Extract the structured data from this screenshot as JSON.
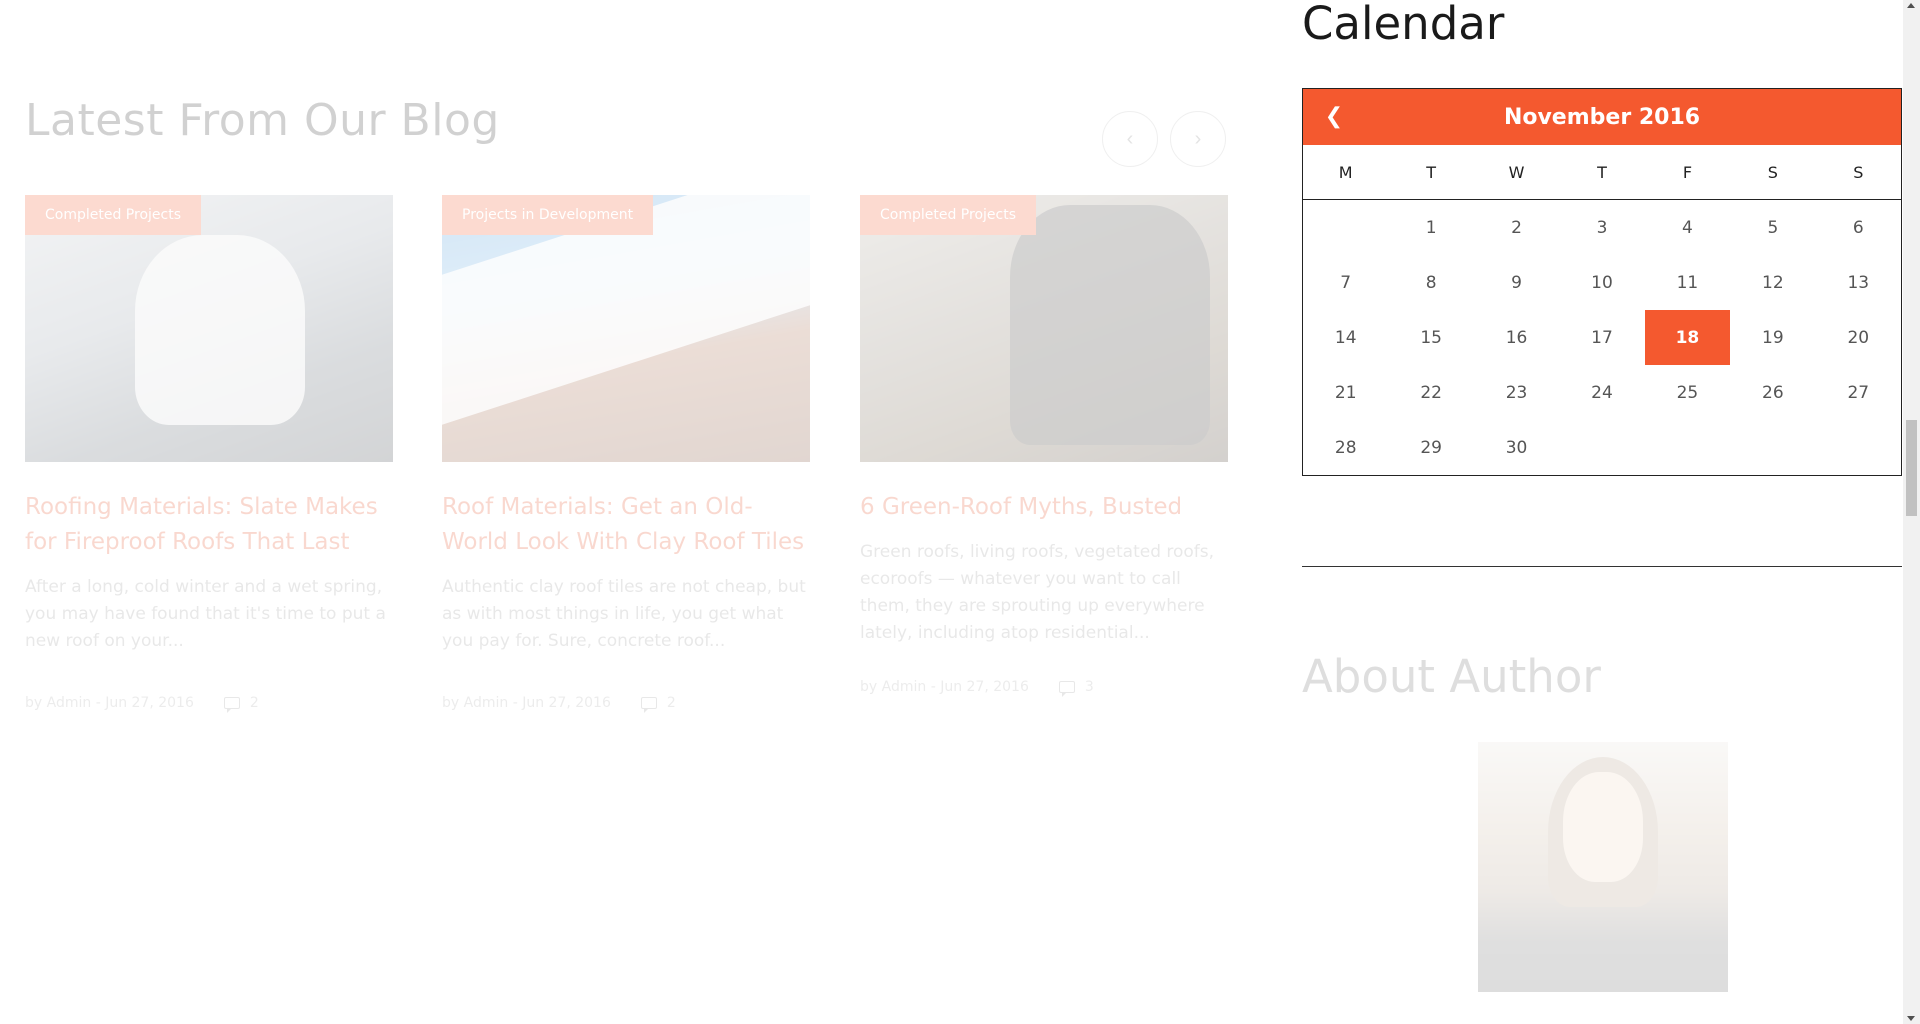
{
  "blog": {
    "title": "Latest From Our Blog",
    "nav_prev_icon": "chevron-left-icon",
    "nav_next_icon": "chevron-right-icon",
    "posts": [
      {
        "category": "Completed Projects",
        "title": "Roofing Materials: Slate Makes for Fireproof Roofs That Last",
        "excerpt": "After a long, cold winter and a wet spring, you may have found that it's time to put a new roof on your...",
        "meta": "by Admin - Jun 27, 2016",
        "comments": "2"
      },
      {
        "category": "Projects in Development",
        "title": "Roof Materials: Get an Old-World Look With Clay Roof Tiles",
        "excerpt": "Authentic clay roof tiles are not cheap, but as with most things in life, you get what you pay for. Sure, concrete roof...",
        "meta": "by Admin - Jun 27, 2016",
        "comments": "2"
      },
      {
        "category": "Completed Projects",
        "title": "6 Green-Roof Myths, Busted",
        "excerpt": "Green roofs, living roofs, vegetated roofs, ecoroofs — whatever you want to call them, they are sprouting up everywhere lately, including atop residential...",
        "meta": "by Admin - Jun 27, 2016",
        "comments": "3"
      }
    ]
  },
  "sidebar": {
    "calendar_heading": "Calendar",
    "calendar": {
      "month": "November 2016",
      "prev_icon": "chevron-left-icon",
      "weekdays": [
        "M",
        "T",
        "W",
        "T",
        "F",
        "S",
        "S"
      ],
      "cells": [
        "",
        "1",
        "2",
        "3",
        "4",
        "5",
        "6",
        "7",
        "8",
        "9",
        "10",
        "11",
        "12",
        "13",
        "14",
        "15",
        "16",
        "17",
        "18",
        "19",
        "20",
        "21",
        "22",
        "23",
        "24",
        "25",
        "26",
        "27",
        "28",
        "29",
        "30",
        "",
        "",
        "",
        ""
      ],
      "today": "18",
      "accent_color": "#f4592f"
    },
    "author_heading": "About Author"
  }
}
